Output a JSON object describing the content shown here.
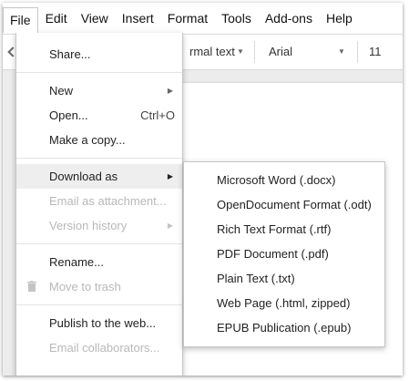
{
  "menubar": {
    "items": [
      "File",
      "Edit",
      "View",
      "Insert",
      "Format",
      "Tools",
      "Add-ons",
      "Help"
    ],
    "active": "File"
  },
  "toolbar": {
    "style_value": "rmal text",
    "font_value": "Arial",
    "size_value": "11"
  },
  "file_menu": {
    "share": "Share...",
    "new": "New",
    "open": "Open...",
    "open_shortcut": "Ctrl+O",
    "make_copy": "Make a copy...",
    "download_as": "Download as",
    "email_attachment": "Email as attachment...",
    "version_history": "Version history",
    "rename": "Rename...",
    "move_trash": "Move to trash",
    "publish": "Publish to the web...",
    "email_collab": "Email collaborators..."
  },
  "download_submenu": {
    "items": [
      "Microsoft Word (.docx)",
      "OpenDocument Format (.odt)",
      "Rich Text Format (.rtf)",
      "PDF Document (.pdf)",
      "Plain Text (.txt)",
      "Web Page (.html, zipped)",
      "EPUB Publication (.epub)"
    ]
  }
}
